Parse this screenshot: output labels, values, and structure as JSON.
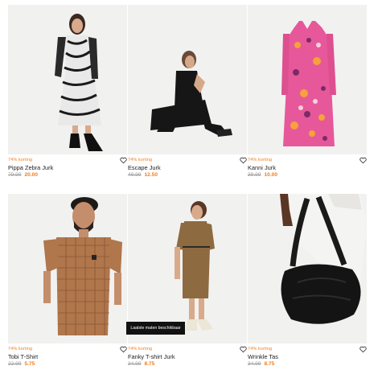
{
  "products": [
    {
      "name": "Pippa Zebra Jurk",
      "discount": "74% korting",
      "old_price": "79.99",
      "new_price": "20.00",
      "image": "woman in zebra print maxi dress"
    },
    {
      "name": "Escape Jurk",
      "discount": "74% korting",
      "old_price": "49.99",
      "new_price": "12.50",
      "image": "woman in black dress sitting"
    },
    {
      "name": "Kanni Jurk",
      "discount": "74% korting",
      "old_price": "39.99",
      "new_price": "10.00",
      "image": "pink floral shirt dress"
    },
    {
      "name": "Tobi T-Shirt",
      "discount": "74% korting",
      "old_price": "22.99",
      "new_price": "5.75",
      "image": "man in brown checked t-shirt"
    },
    {
      "name": "Fanky T-shirt Jurk",
      "discount": "74% korting",
      "old_price": "34.99",
      "new_price": "8.75",
      "image": "woman in brown t-shirt dress"
    },
    {
      "name": "Wrinkle Tas",
      "discount": "74% korting",
      "old_price": "34.99",
      "new_price": "8.75",
      "image": "black leather shoulder bag"
    }
  ],
  "tooltip": "Laatste maten beschikbaar",
  "icons": {
    "wishlist": "heart-outline-icon"
  },
  "colors": {
    "accent": "#f07d1d",
    "muted": "#9b9b9b",
    "image_bg": "#f1f1f0"
  }
}
